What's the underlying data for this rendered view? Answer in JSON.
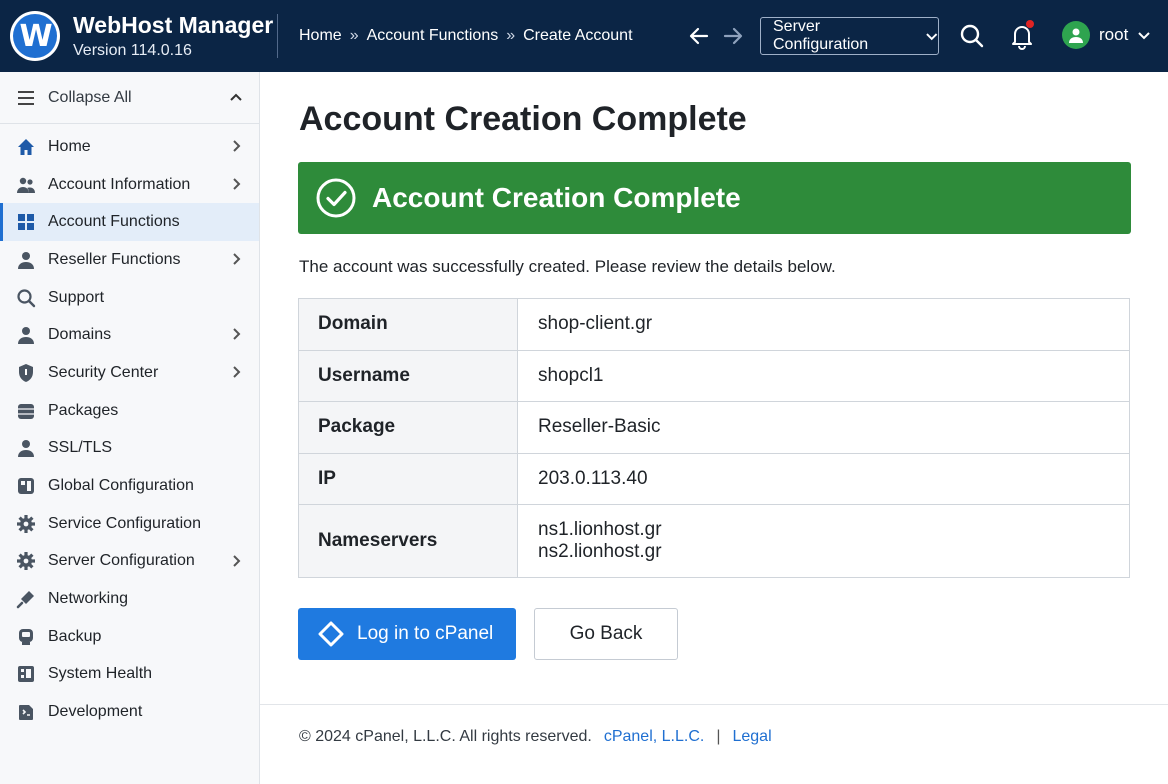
{
  "header": {
    "logo_letter": "W",
    "title": "WebHost Manager",
    "version": "Version 114.0.16",
    "breadcrumb": [
      "Home",
      "Account Functions",
      "Create Account"
    ],
    "breadcrumb_sep": "»",
    "server_select": "Server Configuration",
    "user": "root"
  },
  "sidebar": {
    "collapse_label": "Collapse All",
    "items": [
      {
        "label": "Home",
        "icon": "home-icon",
        "chevron": true
      },
      {
        "label": "Account Information",
        "icon": "users-icon",
        "chevron": true
      },
      {
        "label": "Account Functions",
        "icon": "grid-icon",
        "chevron": false,
        "active": true
      },
      {
        "label": "Reseller Functions",
        "icon": "user-icon",
        "chevron": true
      },
      {
        "label": "Support",
        "icon": "search-icon",
        "chevron": false
      },
      {
        "label": "Domains",
        "icon": "user-icon",
        "chevron": true
      },
      {
        "label": "Security Center",
        "icon": "shield-icon",
        "chevron": true
      },
      {
        "label": "Packages",
        "icon": "database-icon",
        "chevron": false
      },
      {
        "label": "SSL/TLS",
        "icon": "user-icon",
        "chevron": false
      },
      {
        "label": "Global Configuration",
        "icon": "server-icon",
        "chevron": false
      },
      {
        "label": "Service Configuration",
        "icon": "gear-icon",
        "chevron": false
      },
      {
        "label": "Server Configuration",
        "icon": "gear-icon",
        "chevron": true
      },
      {
        "label": "Networking",
        "icon": "plug-icon",
        "chevron": false
      },
      {
        "label": "Backup",
        "icon": "backup-icon",
        "chevron": false
      },
      {
        "label": "System Health",
        "icon": "health-icon",
        "chevron": false
      },
      {
        "label": "Development",
        "icon": "code-icon",
        "chevron": false
      }
    ]
  },
  "main": {
    "title": "Account Creation Complete",
    "banner": "Account Creation Complete",
    "message": "The account was successfully created. Please review the details below.",
    "details": [
      {
        "key": "Domain",
        "value": "shop-client.gr"
      },
      {
        "key": "Username",
        "value": "shopcl1"
      },
      {
        "key": "Package",
        "value": "Reseller-Basic"
      },
      {
        "key": "IP",
        "value": "203.0.113.40"
      },
      {
        "key": "Nameservers",
        "value": [
          "ns1.lionhost.gr",
          "ns2.lionhost.gr"
        ]
      }
    ],
    "login_button": "Log in to cPanel",
    "back_button": "Go Back"
  },
  "footer": {
    "copyright": "© 2024 cPanel, L.L.C. All rights reserved.",
    "company_link": "cPanel, L.L.C.",
    "separator": "|",
    "legal_link": "Legal"
  },
  "colors": {
    "topbar": "#0b2545",
    "success": "#2e8b3a",
    "primary": "#1f7ae0",
    "link": "#1f6fd1"
  }
}
